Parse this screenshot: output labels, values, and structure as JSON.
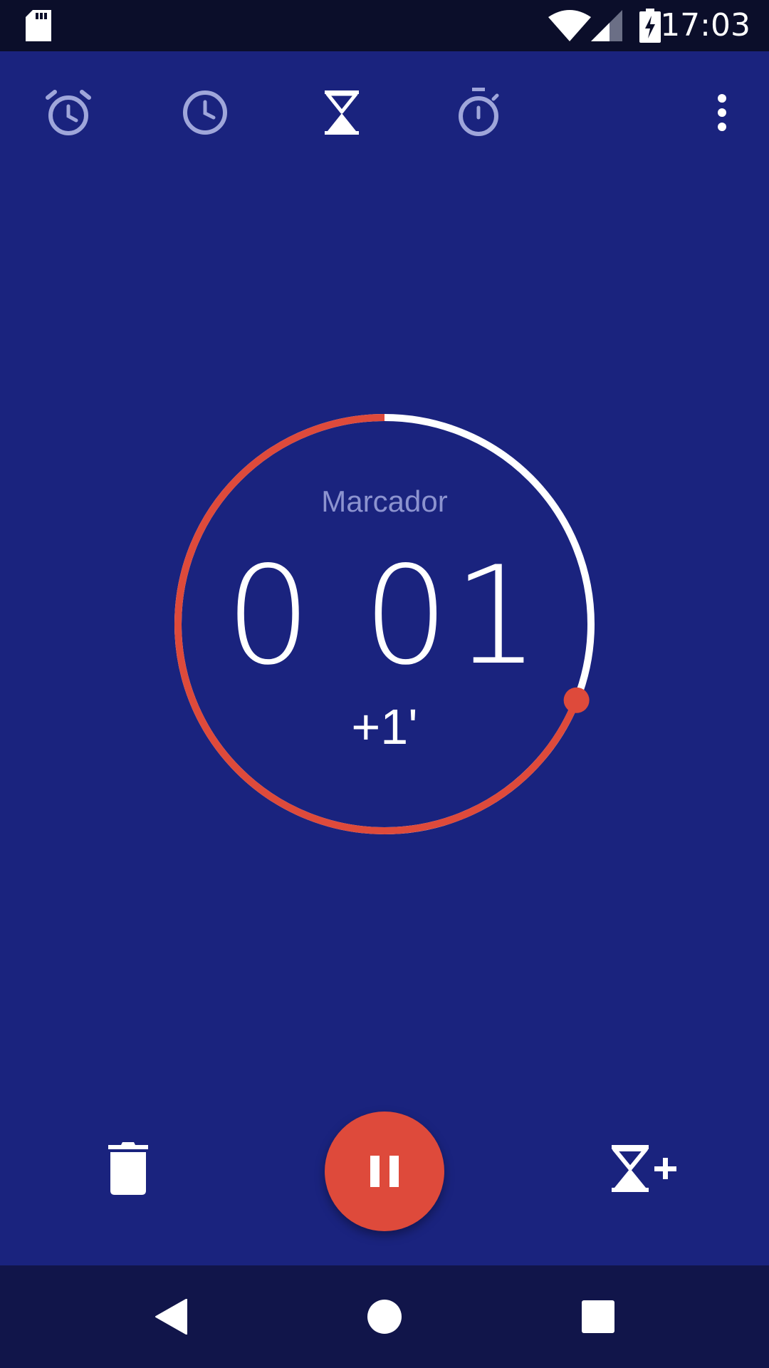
{
  "status_bar": {
    "time": "17:03",
    "icons": [
      "sd-card-icon",
      "wifi-icon",
      "cell-signal-icon",
      "battery-charging-icon"
    ]
  },
  "tabs": [
    {
      "name": "alarm",
      "icon": "alarm-icon",
      "selected": false
    },
    {
      "name": "clock",
      "icon": "clock-icon",
      "selected": false
    },
    {
      "name": "timer",
      "icon": "hourglass-icon",
      "selected": true
    },
    {
      "name": "stopwatch",
      "icon": "stopwatch-icon",
      "selected": false
    }
  ],
  "timer": {
    "label": "Marcador",
    "time_display": "0 01",
    "add_minute_label": "+1'",
    "progress_fraction": 0.31
  },
  "controls": {
    "delete_icon": "trash-icon",
    "pause_icon": "pause-icon",
    "add_timer_icon": "add-timer-icon"
  },
  "colors": {
    "background": "#1a237e",
    "status_bar": "#0b0e2a",
    "nav_bar": "#11154a",
    "accent": "#de4a3b",
    "inactive_icon": "#9fa6da",
    "ring_remaining": "#ffffff"
  }
}
